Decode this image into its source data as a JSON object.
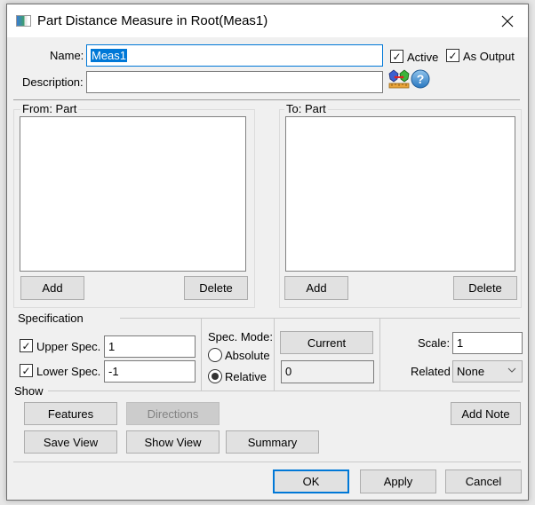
{
  "window": {
    "title": "Part Distance Measure in Root(Meas1)",
    "close_icon": "close-icon"
  },
  "header": {
    "name_label": "Name:",
    "name_value": "Meas1",
    "description_label": "Description:",
    "description_value": "",
    "active_label": "Active",
    "active_checked": true,
    "as_output_label": "As Output",
    "as_output_checked": true,
    "measure_icon": "part-measure-icon",
    "help_icon": "help-icon"
  },
  "from_group": {
    "legend": "From: Part",
    "items": [],
    "add_label": "Add",
    "delete_label": "Delete"
  },
  "to_group": {
    "legend": "To: Part",
    "items": [],
    "add_label": "Add",
    "delete_label": "Delete"
  },
  "specification": {
    "legend": "Specification",
    "upper_label": "Upper Spec.",
    "upper_checked": true,
    "upper_value": "1",
    "lower_label": "Lower Spec.",
    "lower_checked": true,
    "lower_value": "-1",
    "mode_label": "Spec. Mode:",
    "mode_options": [
      "Absolute",
      "Relative"
    ],
    "mode_selected": "Relative",
    "current_label": "Current",
    "current_value": "0",
    "scale_label": "Scale:",
    "scale_value": "1",
    "related_label": "Related",
    "related_value": "None"
  },
  "show": {
    "legend": "Show",
    "features_label": "Features",
    "directions_label": "Directions",
    "add_note_label": "Add Note",
    "save_view_label": "Save View",
    "show_view_label": "Show View",
    "summary_label": "Summary"
  },
  "footer": {
    "ok_label": "OK",
    "apply_label": "Apply",
    "cancel_label": "Cancel"
  }
}
